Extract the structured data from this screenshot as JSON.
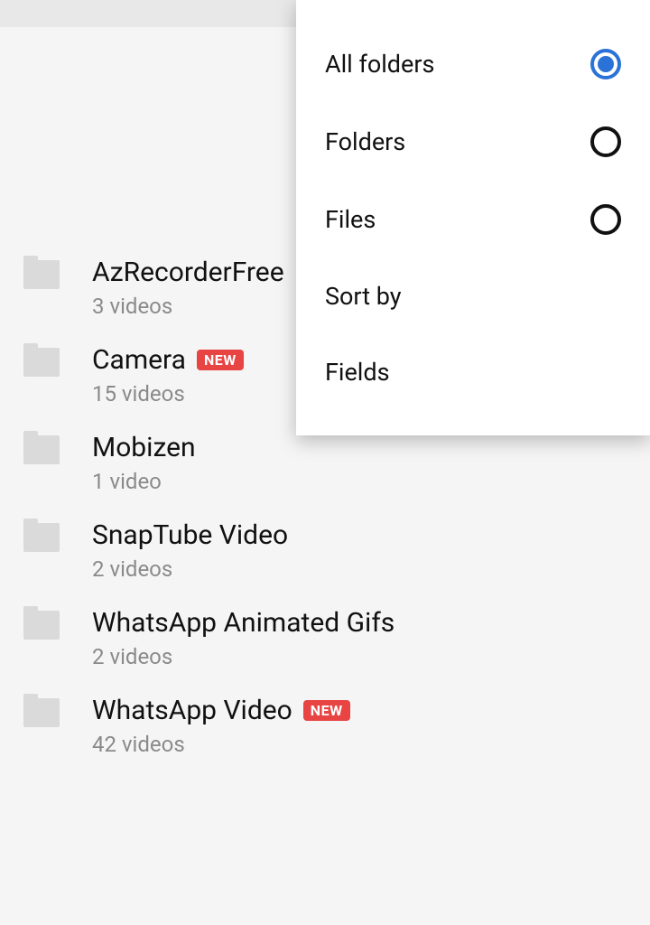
{
  "folders": [
    {
      "name": "AzRecorderFree",
      "sub": "3 videos",
      "new": false
    },
    {
      "name": "Camera",
      "sub": "15 videos",
      "new": true
    },
    {
      "name": "Mobizen",
      "sub": "1 video",
      "new": false
    },
    {
      "name": "SnapTube Video",
      "sub": "2 videos",
      "new": false
    },
    {
      "name": "WhatsApp Animated Gifs",
      "sub": "2 videos",
      "new": false
    },
    {
      "name": "WhatsApp Video",
      "sub": "42 videos",
      "new": true
    }
  ],
  "badge": {
    "new_text": "NEW"
  },
  "menu": {
    "items": [
      {
        "label": "All folders",
        "radio": true,
        "selected": true
      },
      {
        "label": "Folders",
        "radio": true,
        "selected": false
      },
      {
        "label": "Files",
        "radio": true,
        "selected": false
      },
      {
        "label": "Sort by",
        "radio": false,
        "selected": false
      },
      {
        "label": "Fields",
        "radio": false,
        "selected": false
      }
    ]
  }
}
